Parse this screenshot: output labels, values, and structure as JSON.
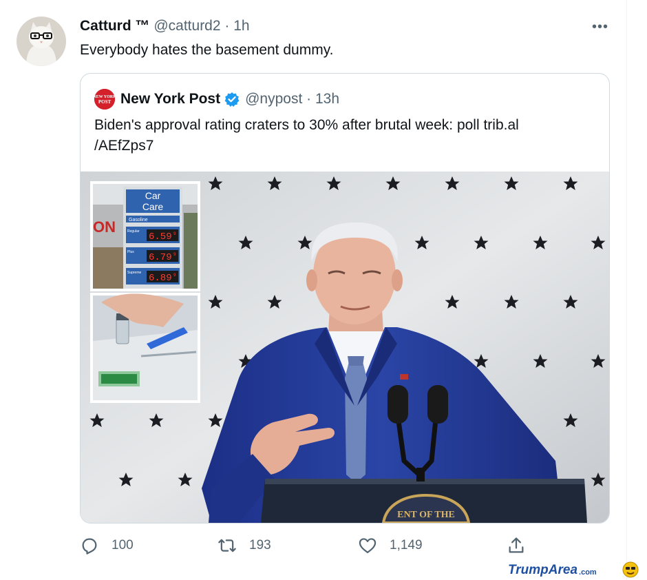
{
  "tweet": {
    "author_name": "Catturd ™",
    "handle": "@catturd2",
    "separator": "·",
    "time": "1h",
    "more": "•••",
    "text": "Everybody hates the basement dummy."
  },
  "quoted": {
    "logo_text": "NEW YORK POST",
    "author_name": "New York Post",
    "handle": "@nypost",
    "separator": "·",
    "time": "13h",
    "text": "Biden's approval rating craters to 30% after brutal week: poll trib.al /AEfZps7",
    "photo": {
      "sign_title_line1": "Car",
      "sign_title_line2": "Care",
      "sign_subtitle": "Gasoline",
      "partial_sign": "ON",
      "grades": [
        {
          "label": "Regular",
          "price": "6.59"
        },
        {
          "label": "Plus",
          "price": "6.79"
        },
        {
          "label": "Supreme",
          "price": "6.89"
        }
      ],
      "price_suffix": "9",
      "seal_text": "ENT OF THE"
    }
  },
  "actions": {
    "reply_count": "100",
    "retweet_count": "193",
    "like_count": "1,149"
  },
  "watermark": {
    "brand_part1": "Trump",
    "brand_part2": "Area",
    "brand_part3": ".com"
  },
  "colors": {
    "muted": "#536471",
    "verified": "#1d9bf0",
    "nypost_red": "#d3202a",
    "suit": "#22399a",
    "border": "#cfd9de"
  },
  "icons": [
    "more-icon",
    "verified-badge-icon",
    "reply-icon",
    "retweet-icon",
    "like-icon",
    "share-icon"
  ]
}
